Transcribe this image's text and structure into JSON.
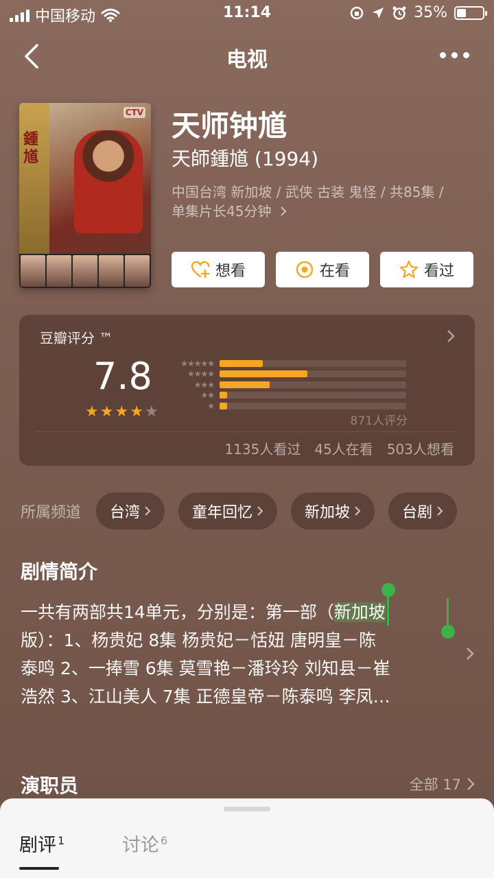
{
  "status_bar": {
    "carrier": "中国移动",
    "time": "11:14",
    "battery_percent_text": "35%",
    "battery_level": 0.35
  },
  "nav": {
    "title": "电视",
    "back_icon": "chevron-left-icon",
    "more_icon": "more-dots-icon"
  },
  "poster": {
    "brand_text": "CTV",
    "side_text": "鍾馗"
  },
  "show": {
    "title": "天师钟馗",
    "original_title": "天師鍾馗 (1994)",
    "meta_line1": "中国台湾 新加坡 / 武侠 古装 鬼怪 / 共85集 /",
    "meta_line2": "单集片长45分钟"
  },
  "actions": [
    {
      "label": "想看",
      "icon": "heart-plus-icon"
    },
    {
      "label": "在看",
      "icon": "target-circle-icon"
    },
    {
      "label": "看过",
      "icon": "star-outline-icon"
    }
  ],
  "rating": {
    "label": "豆瓣评分 ™",
    "score": "7.8",
    "stars_filled": 4,
    "stars_total": 5,
    "distribution": [
      {
        "stars": "★★★★★",
        "fraction": 0.23
      },
      {
        "stars": "★★★★",
        "fraction": 0.47
      },
      {
        "stars": "★★★",
        "fraction": 0.27
      },
      {
        "stars": "★★",
        "fraction": 0.04
      },
      {
        "stars": "★",
        "fraction": 0.04
      }
    ],
    "count_text": "871人评分",
    "watched": "1135人看过",
    "watching": "45人在看",
    "want": "503人想看",
    "accent_color": "#f5a623"
  },
  "channels": {
    "label": "所属频道",
    "items": [
      "台湾",
      "童年回忆",
      "新加坡",
      "台剧"
    ]
  },
  "synopsis": {
    "title": "剧情简介",
    "line1_before": "一共有两部共14单元，分别是：第一部（",
    "line1_selected": "新加坡",
    "line2": "版）：1、杨贵妃 8集 杨贵妃－恬妞 唐明皇－陈",
    "line3": "泰鸣 2、一捧雪 6集 莫雪艳－潘玲玲 刘知县－崔",
    "line4": "浩然 3、江山美人 7集 正德皇帝－陈泰鸣 李凤…",
    "selection_color": "#3cb34a"
  },
  "cast": {
    "title": "演职员",
    "all_label": "全部 17"
  },
  "sheet": {
    "tabs": [
      {
        "label": "剧评",
        "count": "1"
      },
      {
        "label": "讨论",
        "count": "6"
      }
    ]
  }
}
